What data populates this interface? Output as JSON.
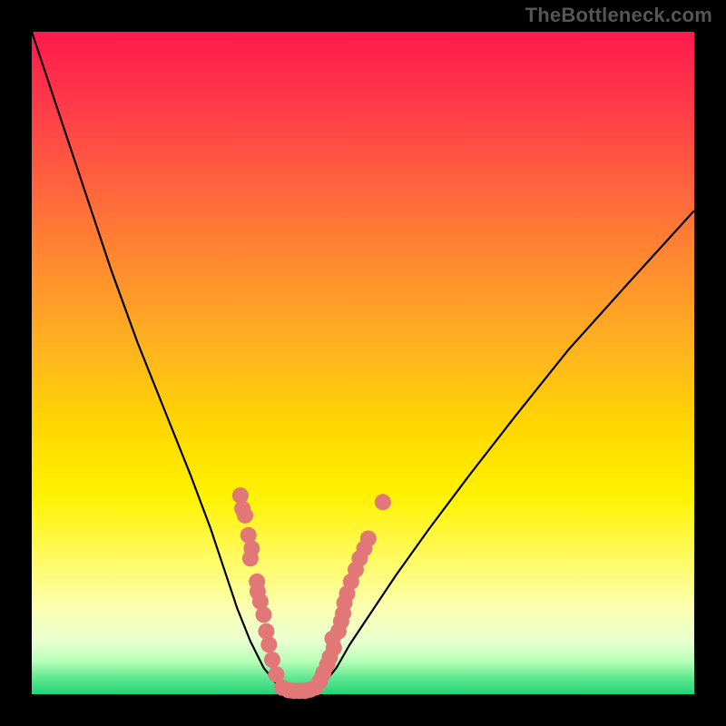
{
  "watermark": "TheBottleneck.com",
  "colors": {
    "frame": "#000000",
    "curve": "#000000",
    "dots": "#e27777",
    "gradient_top": "#ff1a4d",
    "gradient_bottom": "#22d37a"
  },
  "chart_data": {
    "type": "line",
    "title": "",
    "xlabel": "",
    "ylabel": "",
    "xlim": [
      0,
      100
    ],
    "ylim": [
      0,
      100
    ],
    "notes": "Axes are unlabeled; values are estimated from pixel geometry. The plot shows two asymmetric descending/ascending black curves meeting at a flat minimum near x≈38–42, y≈0, over a vertical red→yellow→green gradient. Salmon dots cluster along the curve near the minimum on both sides.",
    "series": [
      {
        "name": "left-curve",
        "x": [
          0,
          4,
          8,
          12,
          16,
          20,
          24,
          27,
          29,
          31,
          33,
          35,
          37,
          38.5
        ],
        "y": [
          100,
          88,
          76,
          64,
          53,
          43,
          33,
          25,
          19,
          13,
          8,
          4,
          1.5,
          0.3
        ]
      },
      {
        "name": "valley-flat",
        "x": [
          38.5,
          39.5,
          40.5,
          41.5,
          42.5
        ],
        "y": [
          0.3,
          0.2,
          0.2,
          0.25,
          0.4
        ]
      },
      {
        "name": "right-curve",
        "x": [
          42.5,
          44,
          46,
          48,
          51,
          55,
          60,
          66,
          73,
          81,
          90,
          100
        ],
        "y": [
          0.4,
          1.5,
          4,
          7.5,
          12,
          18,
          25,
          33,
          42,
          52,
          62,
          73
        ]
      }
    ],
    "scatter": [
      {
        "name": "dots-left",
        "points": [
          [
            31.5,
            30
          ],
          [
            31.8,
            28
          ],
          [
            32.2,
            27
          ],
          [
            32.7,
            24
          ],
          [
            33.2,
            22
          ],
          [
            33.0,
            20.5
          ],
          [
            34.0,
            17
          ],
          [
            34.1,
            15.5
          ],
          [
            34.5,
            14
          ],
          [
            35.0,
            12
          ],
          [
            35.4,
            9.5
          ],
          [
            35.8,
            7.5
          ],
          [
            36.3,
            5.2
          ],
          [
            36.9,
            3.0
          ]
        ]
      },
      {
        "name": "dots-valley",
        "points": [
          [
            37.8,
            1.0
          ],
          [
            38.8,
            0.6
          ],
          [
            39.6,
            0.5
          ],
          [
            40.4,
            0.5
          ],
          [
            41.2,
            0.5
          ],
          [
            42.0,
            0.7
          ],
          [
            42.8,
            1.0
          ]
        ]
      },
      {
        "name": "dots-right",
        "points": [
          [
            43.5,
            2.0
          ],
          [
            44.0,
            3.2
          ],
          [
            44.6,
            4.5
          ],
          [
            45.0,
            5.6
          ],
          [
            45.6,
            7.0
          ],
          [
            45.4,
            8.4
          ],
          [
            46.3,
            9.5
          ],
          [
            46.7,
            11.0
          ],
          [
            47.0,
            12.2
          ],
          [
            47.2,
            13.8
          ],
          [
            47.6,
            15.2
          ],
          [
            48.2,
            17.0
          ],
          [
            48.9,
            18.8
          ],
          [
            49.5,
            20.5
          ],
          [
            50.2,
            22.0
          ],
          [
            50.8,
            23.5
          ],
          [
            53.0,
            29.0
          ]
        ]
      }
    ]
  }
}
